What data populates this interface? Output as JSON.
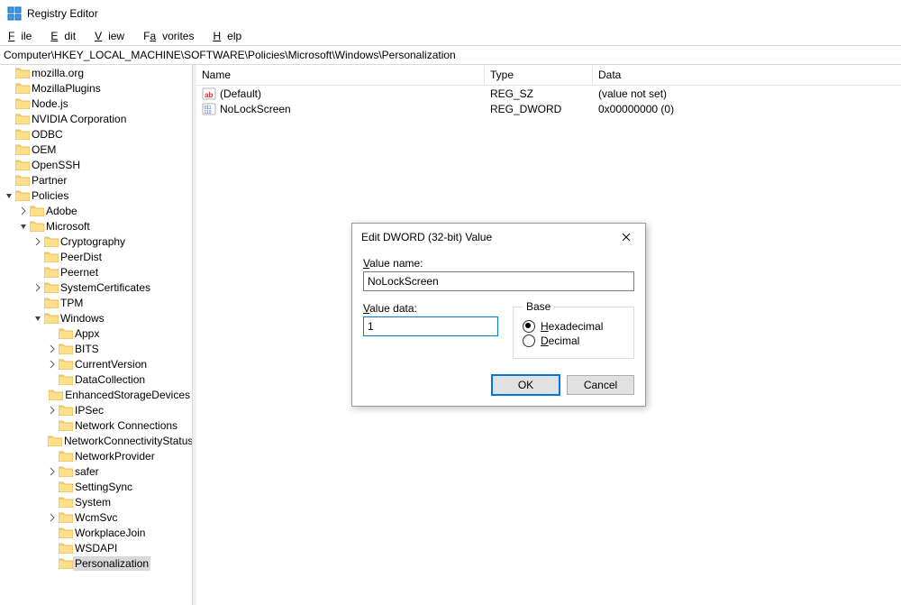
{
  "titlebar": {
    "title": "Registry Editor"
  },
  "menubar": {
    "file": "ile",
    "edit": "dit",
    "view": "iew",
    "favorites": "vorites",
    "help": "elp"
  },
  "address": "Computer\\HKEY_LOCAL_MACHINE\\SOFTWARE\\Policies\\Microsoft\\Windows\\Personalization",
  "list": {
    "columns": [
      "Name",
      "Type",
      "Data"
    ],
    "rows": [
      {
        "icon": "string",
        "name": "(Default)",
        "type": "REG_SZ",
        "data": "(value not set)"
      },
      {
        "icon": "binary",
        "name": "NoLockScreen",
        "type": "REG_DWORD",
        "data": "0x00000000 (0)"
      }
    ]
  },
  "dialog": {
    "title": "Edit DWORD (32-bit) Value",
    "value_name_label": "alue name:",
    "value_name": "NoLockScreen",
    "value_data_label": "alue data:",
    "value_data": "1",
    "base_label": "Base",
    "base_hex": "exadecimal",
    "base_dec": "ecimal",
    "base_selected": "hex",
    "ok": "OK",
    "cancel": "Cancel"
  },
  "tree": [
    {
      "d": 0,
      "tw": "",
      "label": "mozilla.org"
    },
    {
      "d": 0,
      "tw": "",
      "label": "MozillaPlugins"
    },
    {
      "d": 0,
      "tw": "",
      "label": "Node.js"
    },
    {
      "d": 0,
      "tw": "",
      "label": "NVIDIA Corporation"
    },
    {
      "d": 0,
      "tw": "",
      "label": "ODBC"
    },
    {
      "d": 0,
      "tw": "",
      "label": "OEM"
    },
    {
      "d": 0,
      "tw": "",
      "label": "OpenSSH"
    },
    {
      "d": 0,
      "tw": "",
      "label": "Partner"
    },
    {
      "d": 0,
      "tw": "open",
      "label": "Policies"
    },
    {
      "d": 1,
      "tw": "closed",
      "label": "Adobe"
    },
    {
      "d": 1,
      "tw": "open",
      "label": "Microsoft"
    },
    {
      "d": 2,
      "tw": "closed",
      "label": "Cryptography"
    },
    {
      "d": 2,
      "tw": "",
      "label": "PeerDist"
    },
    {
      "d": 2,
      "tw": "",
      "label": "Peernet"
    },
    {
      "d": 2,
      "tw": "closed",
      "label": "SystemCertificates"
    },
    {
      "d": 2,
      "tw": "",
      "label": "TPM"
    },
    {
      "d": 2,
      "tw": "open",
      "label": "Windows"
    },
    {
      "d": 3,
      "tw": "",
      "label": "Appx"
    },
    {
      "d": 3,
      "tw": "closed",
      "label": "BITS"
    },
    {
      "d": 3,
      "tw": "closed",
      "label": "CurrentVersion"
    },
    {
      "d": 3,
      "tw": "",
      "label": "DataCollection"
    },
    {
      "d": 3,
      "tw": "",
      "label": "EnhancedStorageDevices"
    },
    {
      "d": 3,
      "tw": "closed",
      "label": "IPSec"
    },
    {
      "d": 3,
      "tw": "",
      "label": "Network Connections"
    },
    {
      "d": 3,
      "tw": "",
      "label": "NetworkConnectivityStatus"
    },
    {
      "d": 3,
      "tw": "",
      "label": "NetworkProvider"
    },
    {
      "d": 3,
      "tw": "closed",
      "label": "safer"
    },
    {
      "d": 3,
      "tw": "",
      "label": "SettingSync"
    },
    {
      "d": 3,
      "tw": "",
      "label": "System"
    },
    {
      "d": 3,
      "tw": "closed",
      "label": "WcmSvc"
    },
    {
      "d": 3,
      "tw": "",
      "label": "WorkplaceJoin"
    },
    {
      "d": 3,
      "tw": "",
      "label": "WSDAPI"
    },
    {
      "d": 3,
      "tw": "",
      "label": "Personalization",
      "sel": true
    }
  ]
}
